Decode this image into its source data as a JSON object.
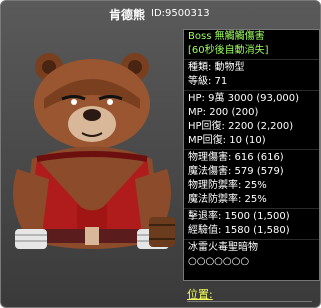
{
  "header": {
    "title": "肯德熊",
    "id_label": "ID:9500313"
  },
  "stats": {
    "boss_label": "Boss 無觸觸傷害",
    "regen_label": "[60秒後自動消失]",
    "species": "種類: 動物型",
    "level": "等級: 71",
    "hp": "HP: 9萬 3000 (93,000)",
    "mp": "MP: 200 (200)",
    "hp_regen": "HP回復: 2200 (2,200)",
    "mp_regen": "MP回復: 10 (10)",
    "phys_dmg": "物理傷害: 616 (616)",
    "magic_dmg": "魔法傷害: 579 (579)",
    "phys_def": "物理防禦率: 25%",
    "magic_def": "魔法防禦率: 25%",
    "knockback": "擊退率: 1500 (1,500)",
    "exp": "經驗值: 1580 (1,580)",
    "elements": "冰雷火毒聖暗物",
    "element_marks": "○○○○○○○",
    "location": "位置:"
  },
  "colors": {
    "green": "#9cff5c",
    "yellow": "#f4ff5c"
  }
}
